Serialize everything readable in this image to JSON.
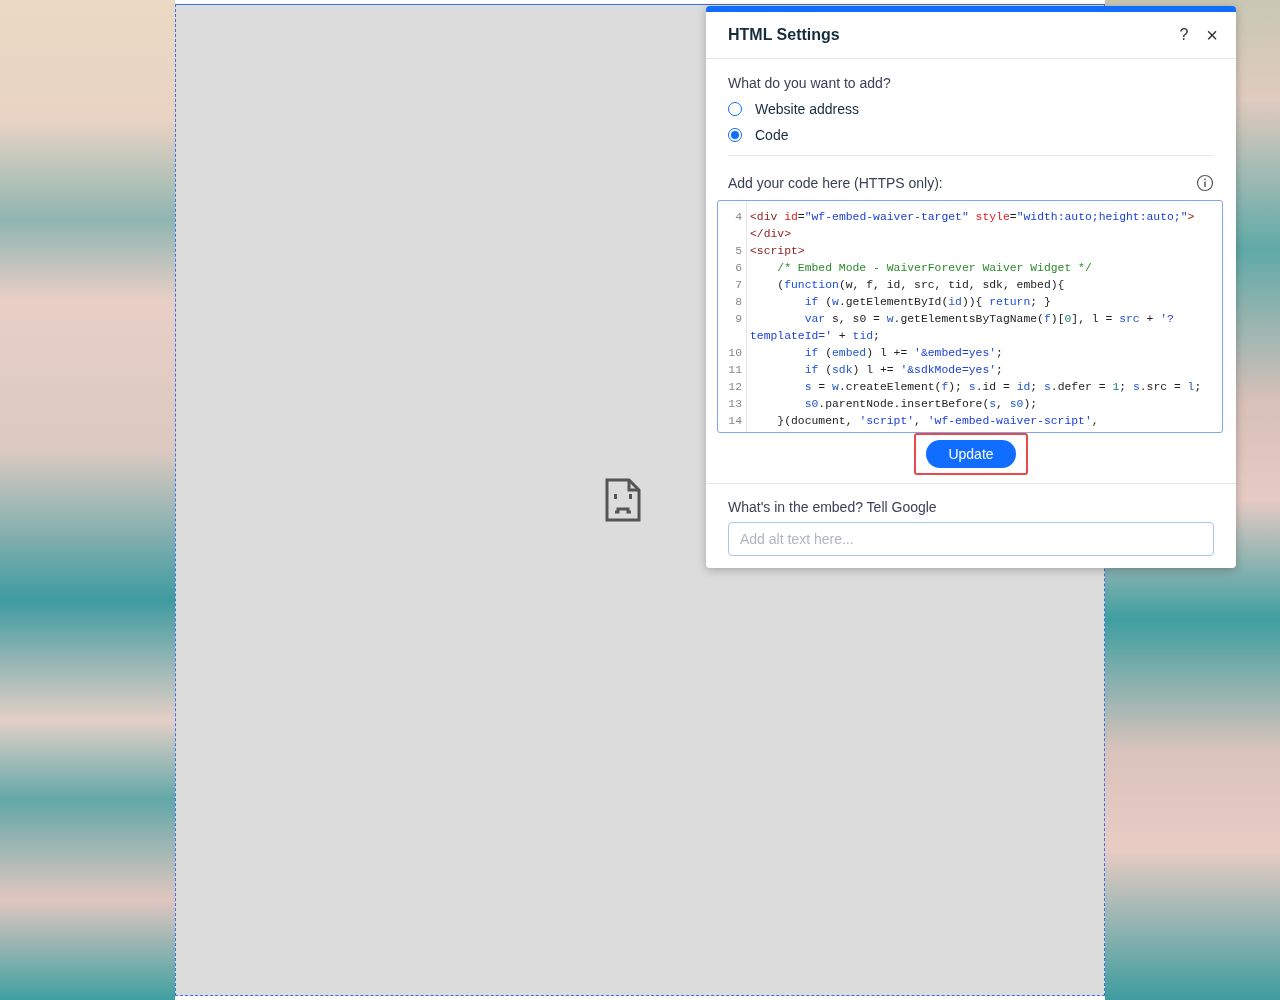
{
  "dialog": {
    "title": "HTML Settings",
    "help": "?",
    "close": "×",
    "question": "What do you want to add?",
    "options": [
      {
        "label": "Website address",
        "selected": false
      },
      {
        "label": "Code",
        "selected": true
      }
    ],
    "code_label": "Add your code here (HTTPS only):",
    "code_rows": [
      {
        "number": "4",
        "tokens": [
          {
            "kind": "tag",
            "text": "<div "
          },
          {
            "kind": "attr",
            "text": "id"
          },
          {
            "kind": "plain",
            "text": "="
          },
          {
            "kind": "string",
            "text": "\"wf-embed-waiver-target\" "
          },
          {
            "kind": "attr",
            "text": "style"
          },
          {
            "kind": "plain",
            "text": "="
          },
          {
            "kind": "string",
            "text": "\"width:auto;height:auto;\""
          },
          {
            "kind": "tag",
            "text": ">"
          }
        ]
      },
      {
        "tokens": [
          {
            "kind": "tag",
            "text": "</div>"
          }
        ]
      },
      {
        "number": "5",
        "tokens": [
          {
            "kind": "tag",
            "text": "<script>"
          }
        ]
      },
      {
        "number": "6",
        "tokens": [
          {
            "kind": "comment",
            "text": "    /* Embed Mode - WaiverForever Waiver Widget */"
          }
        ]
      },
      {
        "number": "7",
        "tokens": [
          {
            "kind": "plain",
            "text": "    ("
          },
          {
            "kind": "keyword",
            "text": "function"
          },
          {
            "kind": "plain",
            "text": "(w, f, id, src, tid, sdk, embed){"
          }
        ]
      },
      {
        "number": "8",
        "tokens": [
          {
            "kind": "keyword",
            "text": "        if"
          },
          {
            "kind": "plain",
            "text": " ("
          },
          {
            "kind": "variable",
            "text": "w"
          },
          {
            "kind": "plain",
            "text": ".getElementById("
          },
          {
            "kind": "variable",
            "text": "id"
          },
          {
            "kind": "plain",
            "text": ")){ "
          },
          {
            "kind": "keyword",
            "text": "return"
          },
          {
            "kind": "plain",
            "text": "; }"
          }
        ]
      },
      {
        "number": "9",
        "tokens": [
          {
            "kind": "keyword",
            "text": "        var"
          },
          {
            "kind": "plain",
            "text": " s, s0 = "
          },
          {
            "kind": "variable",
            "text": "w"
          },
          {
            "kind": "plain",
            "text": ".getElementsByTagName("
          },
          {
            "kind": "variable",
            "text": "f"
          },
          {
            "kind": "plain",
            "text": ")["
          },
          {
            "kind": "number",
            "text": "0"
          },
          {
            "kind": "plain",
            "text": "], l = "
          },
          {
            "kind": "variable",
            "text": "src"
          },
          {
            "kind": "plain",
            "text": " + "
          },
          {
            "kind": "string",
            "text": "'?"
          }
        ]
      },
      {
        "tokens": [
          {
            "kind": "string",
            "text": "templateId='"
          },
          {
            "kind": "plain",
            "text": " + "
          },
          {
            "kind": "variable",
            "text": "tid"
          },
          {
            "kind": "plain",
            "text": ";"
          }
        ]
      },
      {
        "number": "10",
        "tokens": [
          {
            "kind": "keyword",
            "text": "        if"
          },
          {
            "kind": "plain",
            "text": " ("
          },
          {
            "kind": "variable",
            "text": "embed"
          },
          {
            "kind": "plain",
            "text": ") l += "
          },
          {
            "kind": "string",
            "text": "'&embed=yes'"
          },
          {
            "kind": "plain",
            "text": ";"
          }
        ]
      },
      {
        "number": "11",
        "tokens": [
          {
            "kind": "keyword",
            "text": "        if"
          },
          {
            "kind": "plain",
            "text": " ("
          },
          {
            "kind": "variable",
            "text": "sdk"
          },
          {
            "kind": "plain",
            "text": ") l += "
          },
          {
            "kind": "string",
            "text": "'&sdkMode=yes'"
          },
          {
            "kind": "plain",
            "text": ";"
          }
        ]
      },
      {
        "number": "12",
        "tokens": [
          {
            "kind": "variable",
            "text": "        s"
          },
          {
            "kind": "plain",
            "text": " = "
          },
          {
            "kind": "variable",
            "text": "w"
          },
          {
            "kind": "plain",
            "text": ".createElement("
          },
          {
            "kind": "variable",
            "text": "f"
          },
          {
            "kind": "plain",
            "text": "); "
          },
          {
            "kind": "variable",
            "text": "s"
          },
          {
            "kind": "plain",
            "text": ".id = "
          },
          {
            "kind": "variable",
            "text": "id"
          },
          {
            "kind": "plain",
            "text": "; "
          },
          {
            "kind": "variable",
            "text": "s"
          },
          {
            "kind": "plain",
            "text": ".defer = "
          },
          {
            "kind": "number",
            "text": "1"
          },
          {
            "kind": "plain",
            "text": "; "
          },
          {
            "kind": "variable",
            "text": "s"
          },
          {
            "kind": "plain",
            "text": ".src = "
          },
          {
            "kind": "variable",
            "text": "l"
          },
          {
            "kind": "plain",
            "text": ";"
          }
        ]
      },
      {
        "number": "13",
        "tokens": [
          {
            "kind": "variable",
            "text": "        s0"
          },
          {
            "kind": "plain",
            "text": ".parentNode.insertBefore("
          },
          {
            "kind": "variable",
            "text": "s"
          },
          {
            "kind": "plain",
            "text": ", "
          },
          {
            "kind": "variable",
            "text": "s0"
          },
          {
            "kind": "plain",
            "text": ");"
          }
        ]
      },
      {
        "number": "14",
        "tokens": [
          {
            "kind": "plain",
            "text": "    }(document, "
          },
          {
            "kind": "string",
            "text": "'script'"
          },
          {
            "kind": "plain",
            "text": ", "
          },
          {
            "kind": "string",
            "text": "'wf-embed-waiver-script'"
          },
          {
            "kind": "plain",
            "text": ","
          }
        ]
      }
    ],
    "update_button": "Update",
    "alt_label": "What's in the embed? Tell Google",
    "alt_placeholder": "Add alt text here..."
  }
}
